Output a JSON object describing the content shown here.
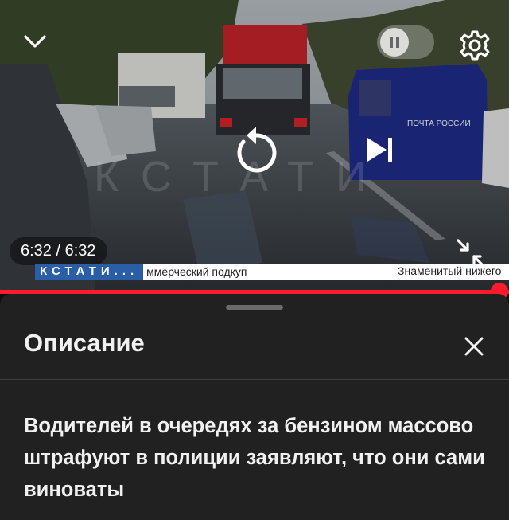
{
  "player": {
    "current_time": "6:32",
    "duration": "6:32",
    "time_display": "6:32 / 6:32",
    "progress": 1.0,
    "ticker": {
      "logo": "КСТАТИ...",
      "headline": "ммерческий подкуп",
      "headline_next": "Знаменитый нижего"
    },
    "truck_sign": "ПОЧТА РОССИИ",
    "accent_color": "#ff1a2e"
  },
  "panel": {
    "title": "Описание",
    "description": "Водителей в очередях за бензином массово штрафуют в полиции заявляют, что они сами виноваты"
  },
  "icons": {
    "collapse": "chevron-down-icon",
    "pause": "pause-icon",
    "settings": "gear-icon",
    "replay": "replay-icon",
    "next": "skip-next-icon",
    "fullscreen": "exit-fullscreen-icon",
    "close": "close-icon"
  }
}
